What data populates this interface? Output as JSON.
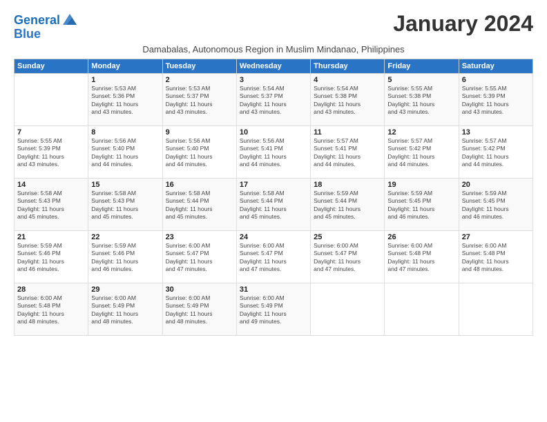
{
  "logo": {
    "line1": "General",
    "line2": "Blue"
  },
  "title": "January 2024",
  "subtitle": "Damabalas, Autonomous Region in Muslim Mindanao, Philippines",
  "days_header": [
    "Sunday",
    "Monday",
    "Tuesday",
    "Wednesday",
    "Thursday",
    "Friday",
    "Saturday"
  ],
  "weeks": [
    [
      {
        "num": "",
        "info": ""
      },
      {
        "num": "1",
        "info": "Sunrise: 5:53 AM\nSunset: 5:36 PM\nDaylight: 11 hours\nand 43 minutes."
      },
      {
        "num": "2",
        "info": "Sunrise: 5:53 AM\nSunset: 5:37 PM\nDaylight: 11 hours\nand 43 minutes."
      },
      {
        "num": "3",
        "info": "Sunrise: 5:54 AM\nSunset: 5:37 PM\nDaylight: 11 hours\nand 43 minutes."
      },
      {
        "num": "4",
        "info": "Sunrise: 5:54 AM\nSunset: 5:38 PM\nDaylight: 11 hours\nand 43 minutes."
      },
      {
        "num": "5",
        "info": "Sunrise: 5:55 AM\nSunset: 5:38 PM\nDaylight: 11 hours\nand 43 minutes."
      },
      {
        "num": "6",
        "info": "Sunrise: 5:55 AM\nSunset: 5:39 PM\nDaylight: 11 hours\nand 43 minutes."
      }
    ],
    [
      {
        "num": "7",
        "info": "Sunrise: 5:55 AM\nSunset: 5:39 PM\nDaylight: 11 hours\nand 43 minutes."
      },
      {
        "num": "8",
        "info": "Sunrise: 5:56 AM\nSunset: 5:40 PM\nDaylight: 11 hours\nand 44 minutes."
      },
      {
        "num": "9",
        "info": "Sunrise: 5:56 AM\nSunset: 5:40 PM\nDaylight: 11 hours\nand 44 minutes."
      },
      {
        "num": "10",
        "info": "Sunrise: 5:56 AM\nSunset: 5:41 PM\nDaylight: 11 hours\nand 44 minutes."
      },
      {
        "num": "11",
        "info": "Sunrise: 5:57 AM\nSunset: 5:41 PM\nDaylight: 11 hours\nand 44 minutes."
      },
      {
        "num": "12",
        "info": "Sunrise: 5:57 AM\nSunset: 5:42 PM\nDaylight: 11 hours\nand 44 minutes."
      },
      {
        "num": "13",
        "info": "Sunrise: 5:57 AM\nSunset: 5:42 PM\nDaylight: 11 hours\nand 44 minutes."
      }
    ],
    [
      {
        "num": "14",
        "info": "Sunrise: 5:58 AM\nSunset: 5:43 PM\nDaylight: 11 hours\nand 45 minutes."
      },
      {
        "num": "15",
        "info": "Sunrise: 5:58 AM\nSunset: 5:43 PM\nDaylight: 11 hours\nand 45 minutes."
      },
      {
        "num": "16",
        "info": "Sunrise: 5:58 AM\nSunset: 5:44 PM\nDaylight: 11 hours\nand 45 minutes."
      },
      {
        "num": "17",
        "info": "Sunrise: 5:58 AM\nSunset: 5:44 PM\nDaylight: 11 hours\nand 45 minutes."
      },
      {
        "num": "18",
        "info": "Sunrise: 5:59 AM\nSunset: 5:44 PM\nDaylight: 11 hours\nand 45 minutes."
      },
      {
        "num": "19",
        "info": "Sunrise: 5:59 AM\nSunset: 5:45 PM\nDaylight: 11 hours\nand 46 minutes."
      },
      {
        "num": "20",
        "info": "Sunrise: 5:59 AM\nSunset: 5:45 PM\nDaylight: 11 hours\nand 46 minutes."
      }
    ],
    [
      {
        "num": "21",
        "info": "Sunrise: 5:59 AM\nSunset: 5:46 PM\nDaylight: 11 hours\nand 46 minutes."
      },
      {
        "num": "22",
        "info": "Sunrise: 5:59 AM\nSunset: 5:46 PM\nDaylight: 11 hours\nand 46 minutes."
      },
      {
        "num": "23",
        "info": "Sunrise: 6:00 AM\nSunset: 5:47 PM\nDaylight: 11 hours\nand 47 minutes."
      },
      {
        "num": "24",
        "info": "Sunrise: 6:00 AM\nSunset: 5:47 PM\nDaylight: 11 hours\nand 47 minutes."
      },
      {
        "num": "25",
        "info": "Sunrise: 6:00 AM\nSunset: 5:47 PM\nDaylight: 11 hours\nand 47 minutes."
      },
      {
        "num": "26",
        "info": "Sunrise: 6:00 AM\nSunset: 5:48 PM\nDaylight: 11 hours\nand 47 minutes."
      },
      {
        "num": "27",
        "info": "Sunrise: 6:00 AM\nSunset: 5:48 PM\nDaylight: 11 hours\nand 48 minutes."
      }
    ],
    [
      {
        "num": "28",
        "info": "Sunrise: 6:00 AM\nSunset: 5:48 PM\nDaylight: 11 hours\nand 48 minutes."
      },
      {
        "num": "29",
        "info": "Sunrise: 6:00 AM\nSunset: 5:49 PM\nDaylight: 11 hours\nand 48 minutes."
      },
      {
        "num": "30",
        "info": "Sunrise: 6:00 AM\nSunset: 5:49 PM\nDaylight: 11 hours\nand 48 minutes."
      },
      {
        "num": "31",
        "info": "Sunrise: 6:00 AM\nSunset: 5:49 PM\nDaylight: 11 hours\nand 49 minutes."
      },
      {
        "num": "",
        "info": ""
      },
      {
        "num": "",
        "info": ""
      },
      {
        "num": "",
        "info": ""
      }
    ]
  ]
}
